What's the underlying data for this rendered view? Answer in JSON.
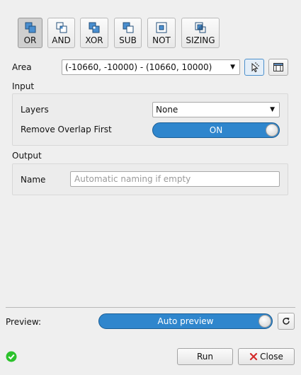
{
  "operations": [
    {
      "id": "or",
      "label": "OR",
      "active": true
    },
    {
      "id": "and",
      "label": "AND",
      "active": false
    },
    {
      "id": "xor",
      "label": "XOR",
      "active": false
    },
    {
      "id": "sub",
      "label": "SUB",
      "active": false
    },
    {
      "id": "not",
      "label": "NOT",
      "active": false
    },
    {
      "id": "sizing",
      "label": "SIZING",
      "active": false
    }
  ],
  "area": {
    "label": "Area",
    "value": "(-10660, -10000) - (10660, 10000)",
    "pick_icon": "cursor-pick-icon",
    "layout_icon": "window-layout-icon"
  },
  "input": {
    "title": "Input",
    "layers_label": "Layers",
    "layers_value": "None",
    "remove_overlap_label": "Remove Overlap First",
    "remove_overlap_state": "ON"
  },
  "output": {
    "title": "Output",
    "name_label": "Name",
    "name_value": "",
    "name_placeholder": "Automatic naming if empty"
  },
  "preview": {
    "label": "Preview:",
    "toggle_label": "Auto preview",
    "refresh_icon": "refresh-icon"
  },
  "footer": {
    "status_icon": "check-circle-icon",
    "run_label": "Run",
    "close_label": "Close",
    "close_icon": "close-x-icon"
  },
  "colors": {
    "accent": "#2f86cd",
    "status_ok": "#2cc22c",
    "close_icon": "#d42a2a"
  }
}
